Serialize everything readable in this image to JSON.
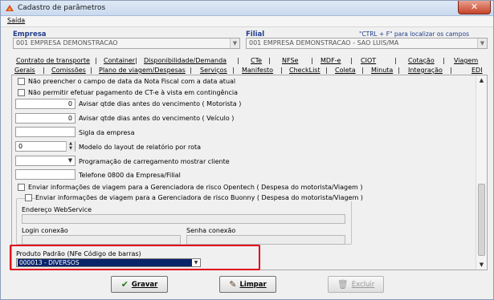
{
  "window": {
    "title": "Cadastro de parâmetros",
    "close_icon": "close-icon"
  },
  "menu": {
    "items": [
      "Saída"
    ]
  },
  "empresa": {
    "label": "Empresa",
    "value": "001 EMPRESA DEMONSTRACAO"
  },
  "filial": {
    "label": "Filial",
    "value": "001 EMPRESA DEMONSTRACAO - SAO LUIS/MA",
    "hint": "\"CTRL + F\" para localizar os campos"
  },
  "tabs_row1": [
    "Contrato de transporte",
    "Container",
    "Disponibilidade/Demanda",
    "CTe",
    "NFSe",
    "MDF-e",
    "CIOT",
    "Cotação",
    "Viagem"
  ],
  "tabs_row2": [
    "Gerais",
    "Comissões",
    "Plano de viagem/Despesas",
    "Serviços",
    "Manifesto",
    "CheckList",
    "Coleta",
    "Minuta",
    "Integração",
    "EDI"
  ],
  "active_tab": "Gerais",
  "form": {
    "check_nota": "Não preencher o campo de data da Nota Fiscal com a data atual",
    "check_ct": "Não permitir efetuar pagamento de CT-e à vista em contingência",
    "avisar_motorista_value": "0",
    "avisar_motorista_label": "Avisar qtde dias antes do vencimento ( Motorista )",
    "avisar_veiculo_value": "0",
    "avisar_veiculo_label": "Avisar qtde dias antes do vencimento ( Veículo )",
    "sigla_label": "Sigla da empresa",
    "sigla_value": "",
    "modelo_value": "0",
    "modelo_label": "Modelo do layout de relatório por rota",
    "programacao_label": "Programação de carregamento mostrar cliente",
    "programacao_value": "",
    "telefone_label": "Telefone 0800 da Empresa/Filial",
    "telefone_value": "",
    "check_opentech": "Enviar informações de viagem para a Gerenciadora de risco Opentech ( Despesa do motorista/Viagem )",
    "check_buonny": "Enviar informações de viagem para a Gerenciadora de risco Buonny ( Despesa do motorista/Viagem )",
    "endereco_label": "Endereço WebService",
    "login_label": "Login conexão",
    "senha_label": "Senha conexão",
    "produto_label": "Produto Padrão (NFe Código de barras)",
    "produto_value": "000013 - DIVERSOS"
  },
  "buttons": {
    "gravar": "Gravar",
    "limpar": "Limpar",
    "excluir": "Excluir"
  },
  "colors": {
    "accent": "#1f3c8a",
    "highlight": "#e0001a",
    "selection": "#0a246a"
  }
}
